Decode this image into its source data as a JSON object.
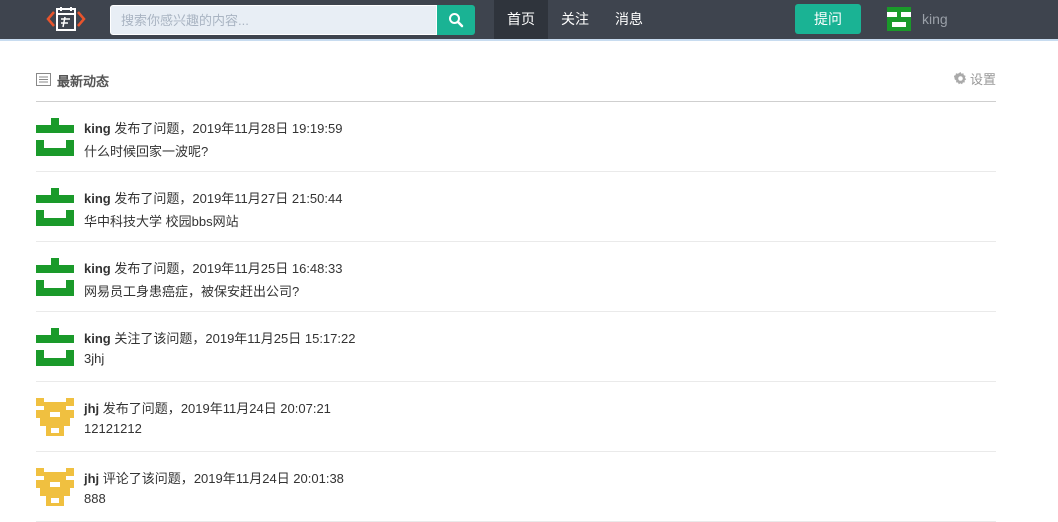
{
  "colors": {
    "navbar": "#3e444e",
    "accent": "#1ab394",
    "green_avatar": "#1a9a2a",
    "yellow_avatar": "#f0c040"
  },
  "navbar": {
    "logo_icon": "calendar-code-logo",
    "search": {
      "placeholder": "搜索你感兴趣的内容...",
      "value": ""
    },
    "search_icon": "search-icon",
    "nav": [
      {
        "label": "首页",
        "active": true
      },
      {
        "label": "关注",
        "active": false
      },
      {
        "label": "消息",
        "active": false
      }
    ],
    "ask_label": "提问",
    "user": {
      "name": "king",
      "avatar": "green-identicon"
    }
  },
  "feed": {
    "title": "最新动态",
    "settings_label": "设置",
    "items": [
      {
        "author": "king",
        "avatar": "green",
        "action": "发布了问题，",
        "time": "2019年11月28日 19:19:59",
        "title": "什么时候回家一波呢?"
      },
      {
        "author": "king",
        "avatar": "green",
        "action": "发布了问题，",
        "time": "2019年11月27日 21:50:44",
        "title": "华中科技大学 校园bbs网站"
      },
      {
        "author": "king",
        "avatar": "green",
        "action": "发布了问题，",
        "time": "2019年11月25日 16:48:33",
        "title": "网易员工身患癌症，被保安赶出公司?"
      },
      {
        "author": "king",
        "avatar": "green",
        "action": "关注了该问题，",
        "time": "2019年11月25日 15:17:22",
        "title": "3jhj"
      },
      {
        "author": "jhj",
        "avatar": "yellow",
        "action": "发布了问题，",
        "time": "2019年11月24日 20:07:21",
        "title": "12121212"
      },
      {
        "author": "jhj",
        "avatar": "yellow",
        "action": "评论了该问题，",
        "time": "2019年11月24日 20:01:38",
        "title": "888"
      }
    ]
  }
}
